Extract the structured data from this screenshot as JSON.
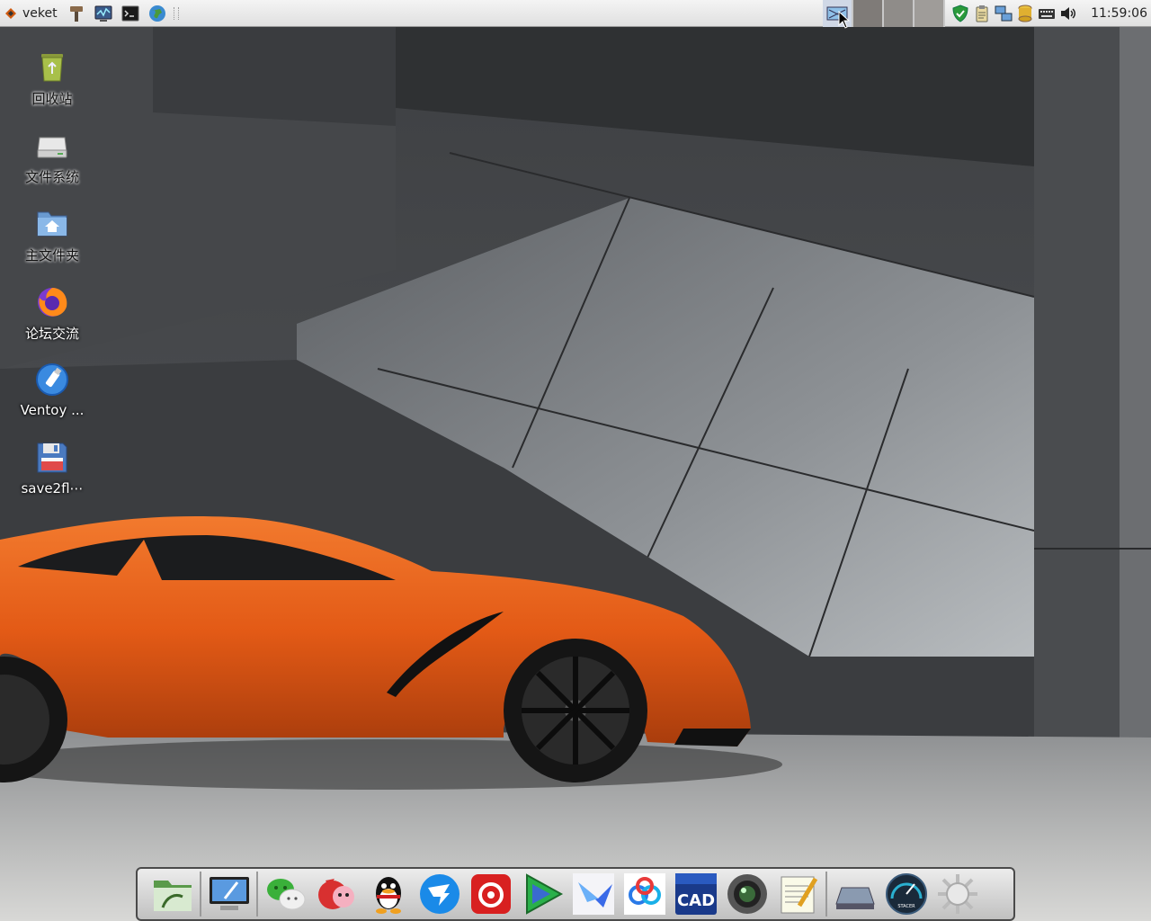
{
  "top_panel": {
    "menu_label": "veket",
    "launchers": [
      "settings-icon",
      "system-monitor-icon",
      "terminal-icon",
      "globe-icon"
    ],
    "workspaces": 4,
    "active_workspace": 1,
    "tray_icons": [
      "shield-icon",
      "clipboard-icon",
      "network-icon",
      "database-icon",
      "keyboard-icon",
      "volume-icon"
    ],
    "clock": "11:59:06"
  },
  "desktop": {
    "icons": [
      {
        "label": "回收站",
        "icon": "recycle-bin-icon"
      },
      {
        "label": "文件系统",
        "icon": "drive-icon"
      },
      {
        "label": "主文件夹",
        "icon": "home-folder-icon"
      },
      {
        "label": "论坛交流",
        "icon": "firefox-icon"
      },
      {
        "label": "Ventoy ...",
        "icon": "usb-drive-icon"
      },
      {
        "label": "save2fl⋯",
        "icon": "floppy-disk-icon"
      }
    ]
  },
  "dock": {
    "items": [
      "file-manager-icon",
      "monitor-settings-icon",
      "wechat-icon",
      "game-icon",
      "qq-icon",
      "dingtalk-icon",
      "netease-music-icon",
      "media-player-icon",
      "feishu-icon",
      "baidu-netdisk-icon",
      "cad-icon",
      "camera-icon",
      "text-editor-icon",
      "scanner-icon",
      "stacer-icon",
      "sun-settings-icon"
    ],
    "cad_text": "CAD",
    "stacer_text": "STACER"
  },
  "colors": {
    "panel_bg": "#e8e8e8",
    "car_orange": "#e8601c",
    "wall_grey": "#5a5c5f"
  }
}
